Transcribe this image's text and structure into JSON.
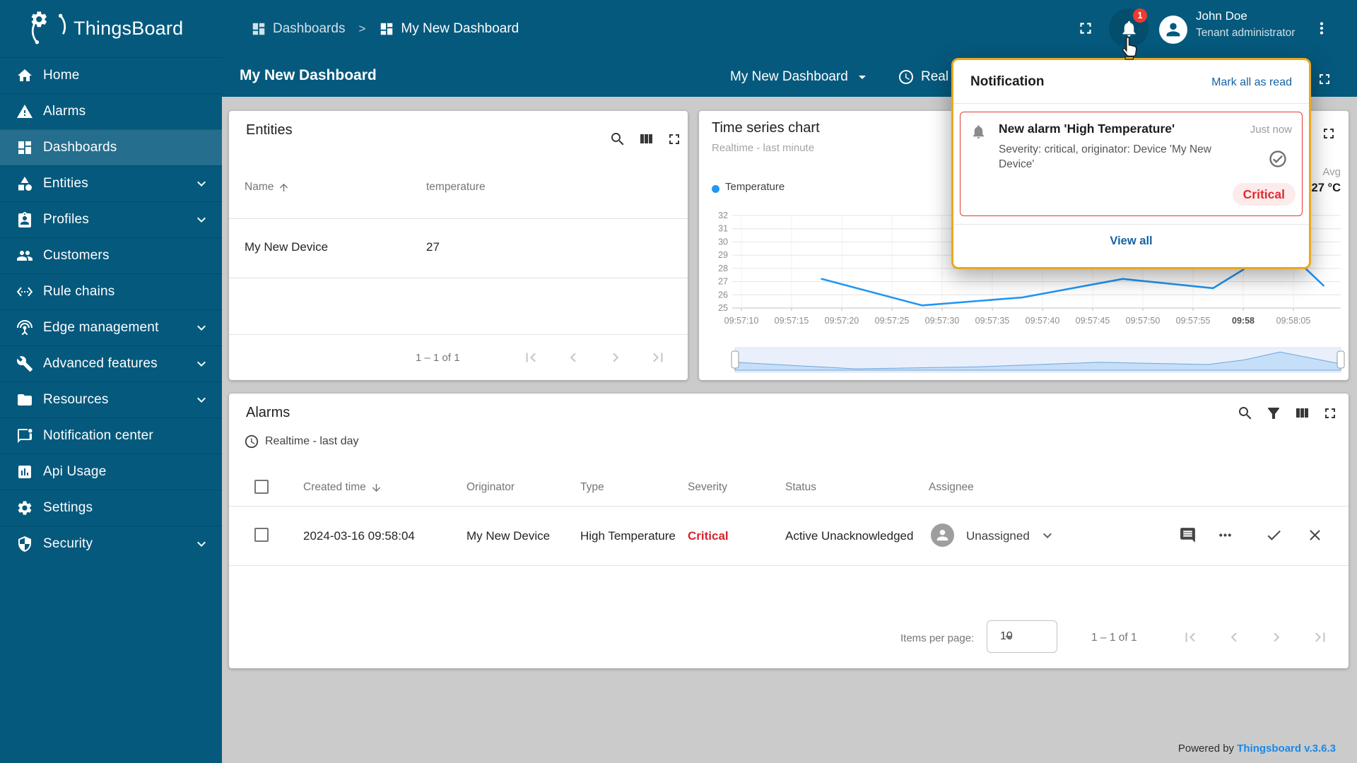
{
  "app": {
    "name": "ThingsBoard"
  },
  "topbar": {
    "breadcrumb": {
      "parent": "Dashboards",
      "separator": ">",
      "current": "My New Dashboard"
    },
    "notifications_badge": "1",
    "user": {
      "name": "John Doe",
      "role": "Tenant administrator"
    }
  },
  "toolbar": {
    "title": "My New Dashboard",
    "state_selector": "My New Dashboard",
    "timewindow_label_clipped": "Real"
  },
  "sidebar": {
    "items": [
      {
        "label": "Home",
        "icon": "home"
      },
      {
        "label": "Alarms",
        "icon": "warning"
      },
      {
        "label": "Dashboards",
        "icon": "dashboard",
        "active": true
      },
      {
        "label": "Entities",
        "icon": "category",
        "expandable": true
      },
      {
        "label": "Profiles",
        "icon": "badge",
        "expandable": true
      },
      {
        "label": "Customers",
        "icon": "people"
      },
      {
        "label": "Rule chains",
        "icon": "ethernet"
      },
      {
        "label": "Edge management",
        "icon": "antenna",
        "expandable": true
      },
      {
        "label": "Advanced features",
        "icon": "build",
        "expandable": true
      },
      {
        "label": "Resources",
        "icon": "folder",
        "expandable": true
      },
      {
        "label": "Notification center",
        "icon": "notif-center"
      },
      {
        "label": "Api Usage",
        "icon": "insert-chart"
      },
      {
        "label": "Settings",
        "icon": "gear"
      },
      {
        "label": "Security",
        "icon": "shield",
        "expandable": true
      }
    ]
  },
  "widgets": {
    "entities": {
      "title": "Entities",
      "columns": [
        "Name",
        "temperature"
      ],
      "rows": [
        {
          "name": "My New Device",
          "temperature": "27"
        }
      ],
      "range_label": "1 – 1 of 1"
    },
    "timeseries": {
      "title": "Time series chart",
      "subtitle": "Realtime - last minute",
      "legend": {
        "label": "Temperature",
        "color": "#2196f3"
      },
      "agg_header": "Avg",
      "agg_value": "27 °C",
      "chart_data": {
        "type": "line",
        "title": "Time series chart",
        "x_ticks": [
          "09:57:10",
          "09:57:15",
          "09:57:20",
          "09:57:25",
          "09:57:30",
          "09:57:35",
          "09:57:40",
          "09:57:45",
          "09:57:50",
          "09:57:55",
          "09:58",
          "09:58:05"
        ],
        "x_bold_tick": "09:58",
        "y_ticks": [
          25,
          26,
          27,
          28,
          29,
          30,
          31,
          32
        ],
        "ylim": [
          25,
          32
        ],
        "grid": true,
        "legend_position": "top-left",
        "series": [
          {
            "name": "Temperature",
            "color": "#2196f3",
            "points": [
              [
                "09:57:18",
                27.2
              ],
              [
                "09:57:28",
                25.2
              ],
              [
                "09:57:38",
                25.8
              ],
              [
                "09:57:48",
                27.2
              ],
              [
                "09:57:57",
                26.5
              ],
              [
                "09:58:00",
                27.9
              ],
              [
                "09:58:03",
                30.3
              ],
              [
                "09:58:08",
                26.7
              ]
            ]
          }
        ]
      }
    },
    "alarms": {
      "title": "Alarms",
      "timewindow": "Realtime - last day",
      "columns": [
        "Created time",
        "Originator",
        "Type",
        "Severity",
        "Status",
        "Assignee"
      ],
      "rows": [
        {
          "created_time": "2024-03-16 09:58:04",
          "originator": "My New Device",
          "type": "High Temperature",
          "severity": "Critical",
          "status": "Active Unacknowledged",
          "assignee": "Unassigned"
        }
      ],
      "items_per_page_label": "Items per page:",
      "items_per_page": "10",
      "range_label": "1 – 1 of 1"
    }
  },
  "notification_popup": {
    "title": "Notification",
    "mark_all_label": "Mark all as read",
    "view_all_label": "View all",
    "item": {
      "title": "New alarm 'High Temperature'",
      "time": "Just now",
      "description": "Severity: critical, originator: Device 'My New Device'",
      "severity_label": "Critical"
    }
  },
  "footer": {
    "prefix": "Powered by ",
    "link": "Thingsboard v.3.6.3"
  },
  "colors": {
    "primary": "#05597d",
    "popup_border": "#e9a820",
    "critical": "#d9232d",
    "chart_line": "#2196f3",
    "link": "#1762a3",
    "badge_red": "#ef3a30"
  }
}
